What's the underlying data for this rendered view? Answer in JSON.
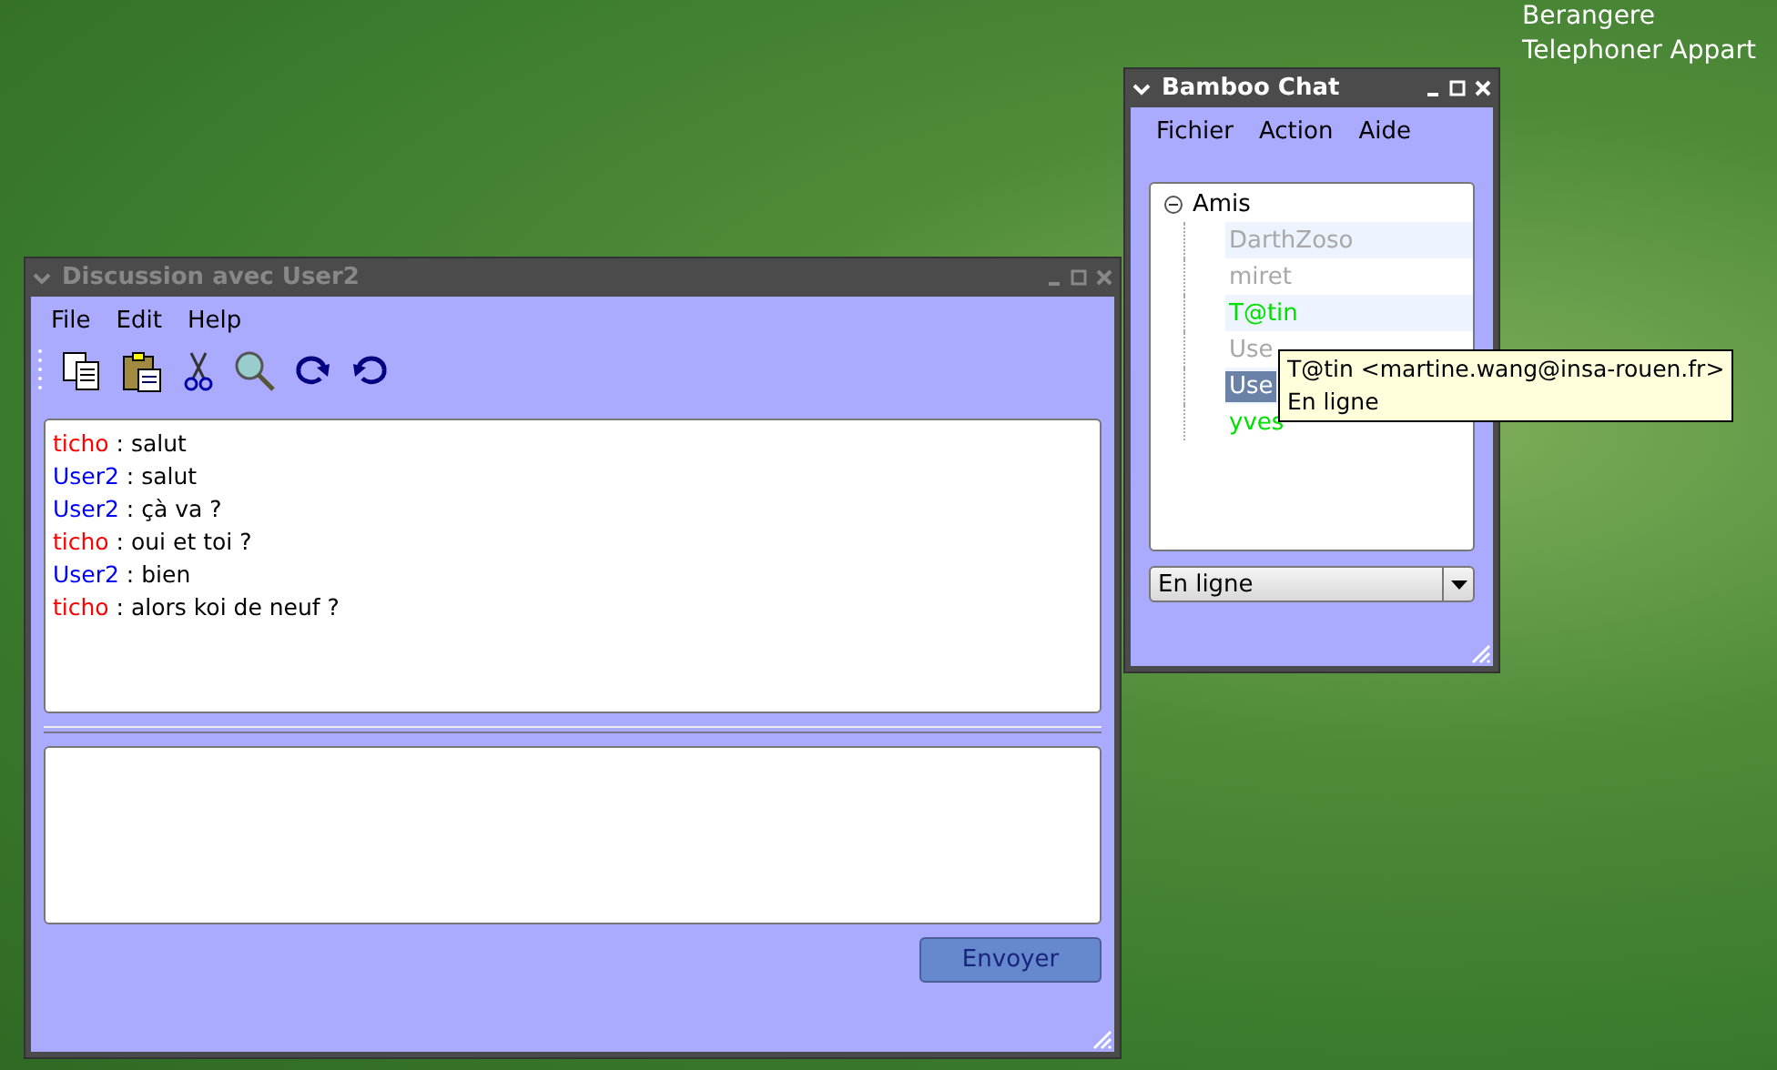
{
  "desktop_labels": [
    "Berangere",
    "Telephoner Appart"
  ],
  "chat_window": {
    "title": "Discussion avec User2",
    "menu": [
      "File",
      "Edit",
      "Help"
    ],
    "messages": [
      {
        "author": "ticho",
        "color": "#ff0000",
        "text": ": salut"
      },
      {
        "author": "User2",
        "color": "#0000ff",
        "text": ": salut"
      },
      {
        "author": "User2",
        "color": "#0000ff",
        "text": ": çà va ?"
      },
      {
        "author": "ticho",
        "color": "#ff0000",
        "text": ": oui et toi ?"
      },
      {
        "author": "User2",
        "color": "#0000ff",
        "text": ": bien"
      },
      {
        "author": "ticho",
        "color": "#ff0000",
        "text": ": alors koi de neuf ?"
      }
    ],
    "send_button": "Envoyer"
  },
  "contacts_window": {
    "title": "Bamboo Chat",
    "menu": [
      "Fichier",
      "Action",
      "Aide"
    ],
    "group": {
      "label": "Amis",
      "expanded": true,
      "children": [
        {
          "label": "DarthZoso",
          "color": "#a8a8a8",
          "selected": false
        },
        {
          "label": "miret",
          "color": "#a8a8a8",
          "selected": false
        },
        {
          "label": "T@tin",
          "color": "#00e000",
          "selected": false
        },
        {
          "label": "Use",
          "color": "#a8a8a8",
          "selected": false
        },
        {
          "label": "Use",
          "color": "#ffffff",
          "selected": true
        },
        {
          "label": "yves",
          "color": "#00e000",
          "selected": false
        }
      ]
    },
    "tooltip": [
      "T@tin <martine.wang@insa-rouen.fr>",
      "En ligne"
    ],
    "status": "En ligne"
  }
}
